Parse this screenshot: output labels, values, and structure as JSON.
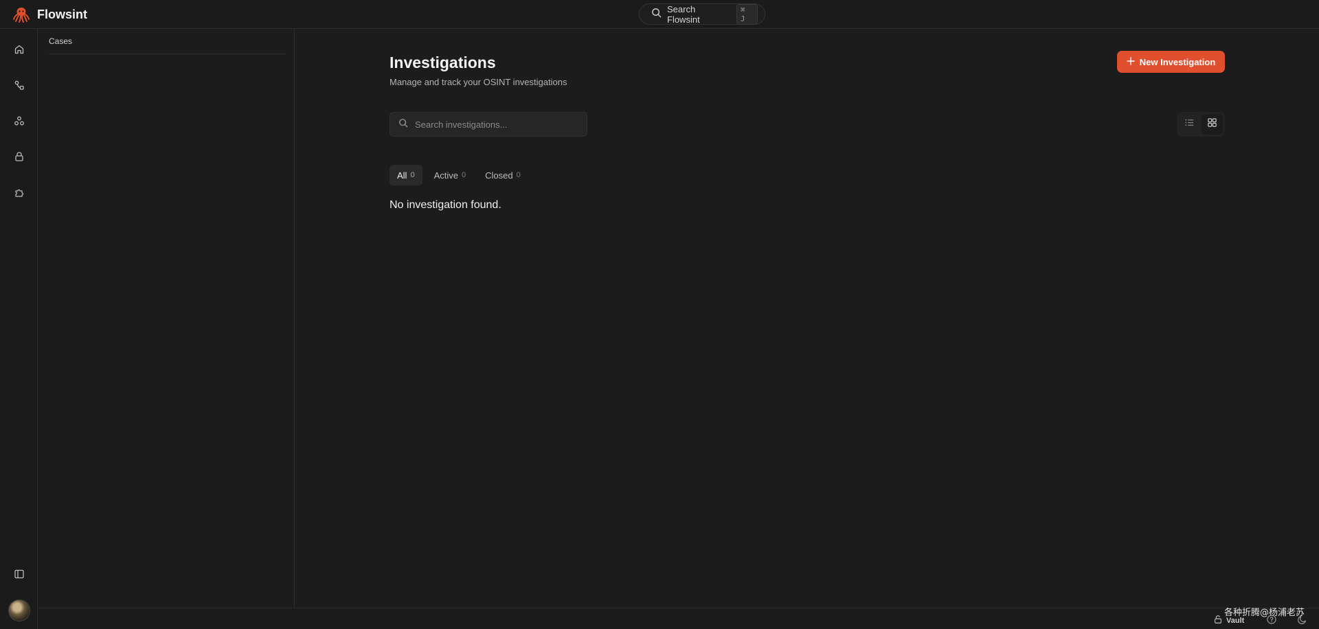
{
  "app": {
    "name": "Flowsint",
    "brand_color": "#e0502e"
  },
  "global_search": {
    "label": "Search Flowsint",
    "shortcut": "⌘ J"
  },
  "rail": {
    "items": [
      {
        "icon": "home-icon"
      },
      {
        "icon": "flow-icon"
      },
      {
        "icon": "shapes-icon"
      },
      {
        "icon": "lock-icon"
      },
      {
        "icon": "puzzle-icon"
      }
    ],
    "bottom": [
      {
        "icon": "panel-toggle-icon"
      },
      {
        "icon": "avatar"
      }
    ]
  },
  "sidepanel": {
    "header": "Cases"
  },
  "main": {
    "title": "Investigations",
    "subtitle": "Manage and track your OSINT investigations",
    "new_button_label": "New Investigation",
    "search_placeholder": "Search investigations...",
    "view_toggle": {
      "active": "grid-view"
    },
    "tabs": [
      {
        "label": "All",
        "count": "0",
        "active": true
      },
      {
        "label": "Active",
        "count": "0",
        "active": false
      },
      {
        "label": "Closed",
        "count": "0",
        "active": false
      }
    ],
    "empty_message": "No investigation found."
  },
  "statusbar": {
    "vault_label": "Vault",
    "watermark": "各种折腾@杨浦老苏"
  }
}
